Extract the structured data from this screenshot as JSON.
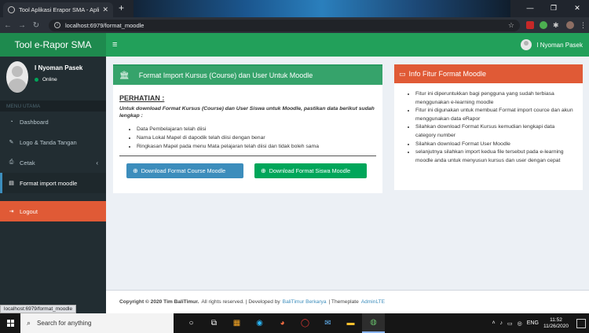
{
  "browser": {
    "tab_title": "Tool Aplikasi Erapor SMA - Aplik",
    "url": "localhost:6979/format_moodle",
    "status_url": "localhost:6979/format_moodle"
  },
  "app": {
    "logo": "Tool e-Rapor SMA",
    "user_name": "I Nyoman Pasek"
  },
  "sidebar": {
    "user_name": "I Nyoman Pasek",
    "status": "Online",
    "header": "MENU UTAMA",
    "items": [
      {
        "label": "Dashboard",
        "icon": "dashboard-icon"
      },
      {
        "label": "Logo & Tanda Tangan",
        "icon": "edit-icon"
      },
      {
        "label": "Cetak",
        "icon": "print-icon"
      },
      {
        "label": "Format import moodle",
        "icon": "file-icon"
      },
      {
        "label": "Logout",
        "icon": "logout-icon"
      }
    ]
  },
  "main": {
    "box_title": "Format Import Kursus (Course) dan User Untuk Moodle",
    "attention": "PERHATIAN :",
    "description": "Untuk download Format Kursus (Course) dan User Siswa untuk Moodle, pastikan data berikut sudah lengkap :",
    "requirements": [
      "Data Pembelajaran telah diisi",
      "Nama Lokal Mapel di dapodik telah diisi dengan benar",
      "Ringkasan Mapel pada menu Mata pelajaran telah diisi dan tidak boleh sama"
    ],
    "btn_course": "Download Format Course Moodle",
    "btn_siswa": "Download Format Siswa Moodle"
  },
  "info": {
    "title": "Info Fitur Format Moodle",
    "items": [
      "Fitur ini diperuntukkan bagi pengguna yang sudah terbiasa menggunakan e-learning moodle",
      "Fitur ini digunakan untuk membuat Format import cource dan akun menggunakan data eRapor",
      "Silahkan download Format Kursus kemudian lengkapi data category number",
      "Silahkan download Format User Moodle",
      "selanjutnya silahkan import kedua file tersebut pada e-learning moodle anda untuk menyusun kursus dan user dengan cepat"
    ]
  },
  "footer": {
    "copyright": "Copyright © 2020 Tim BaliTimur.",
    "rights": "All rights reserved. | Developed by",
    "dev": "BaliTimur Berkarya",
    "sep": "| Themeplate",
    "theme": "AdminLTE"
  },
  "taskbar": {
    "search_placeholder": "Search for anything",
    "lang": "ENG",
    "time": "11:52",
    "date": "11/26/2020"
  }
}
